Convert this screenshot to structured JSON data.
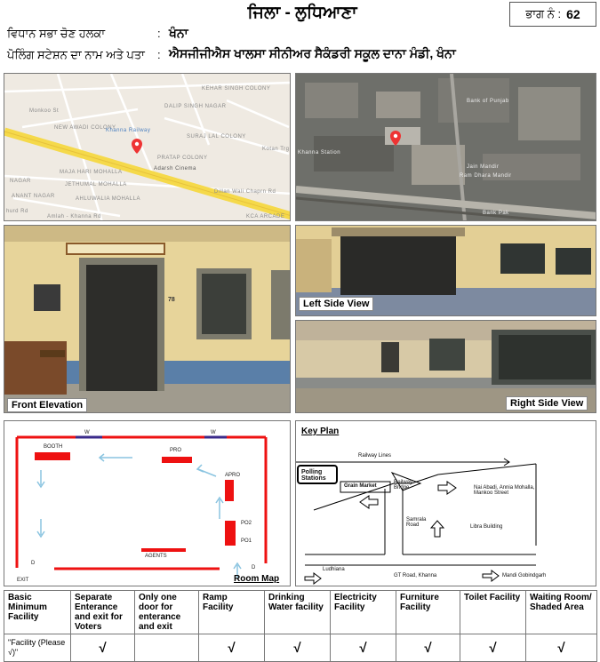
{
  "header": {
    "district": "ਜਿਲਾ - ਲੁਧਿਆਣਾ",
    "part_label": "ਭਾਗ ਨੰ :",
    "part_no": "62",
    "constituency_label": "ਵਿਧਾਨ ਸਭਾ ਚੋਣ ਹਲਕਾ",
    "constituency_value": "ਖੰਨਾ",
    "station_label": "ਪੋਲਿੰਗ ਸਟੇਸ਼ਨ ਦਾ ਨਾਮ ਅਤੇ ਪਤਾ",
    "station_value": "ਐਸਜੀਜੀਐਸ ਖਾਲਸਾ ਸੀਨੀਅਰ ਸੈਕੰਡਰੀ ਸਕੂਲ ਦਾਨਾ ਮੰਡੀ, ਖੰਨਾ",
    "colon": ":"
  },
  "road_map": {
    "labels": [
      "KEHAR SINGH COLONY",
      "Monkoo St",
      "DALIP SINGH NAGAR",
      "NEW AWADI COLONY",
      "Khanna Railway",
      "SURAJ LAL COLONY",
      "PRATAP COLONY",
      "Adarsh Cinema",
      "MAJA HARI MOHALLA",
      "JETHUMAL MOHALLA",
      "NAGAR",
      "ANANT NAGAR",
      "Dillan Wali Chaprn Rd",
      "hurd Rd",
      "Amlah - Khanna Rd",
      "KCA ARCADE",
      "AHLUWALIA MOHALLA",
      "Kotan Trg"
    ]
  },
  "sat_map": {
    "labels": [
      "Khanna Station",
      "Bank of Punjab",
      "Jain Mandir",
      "Ram Dhara Mandir",
      "Bank Pak"
    ]
  },
  "photos": {
    "front": "Front Elevation",
    "left": "Left Side View",
    "right": "Right Side View",
    "room_no": "78"
  },
  "room_map": {
    "title": "Room Map",
    "booth": "BOOTH",
    "pro": "PRO",
    "apro": "APRO",
    "po2": "PO2",
    "po1": "PO1",
    "agents": "AGENTS",
    "exit": "EXIT",
    "w": "W",
    "d": "D"
  },
  "key_plan": {
    "title": "Key Plan",
    "railway_lines": "Railway Lines",
    "polling_stations": "Polling Stations",
    "grain_market": "Grain Market",
    "railway_bridge": "Railway Bridge",
    "nai_abadi": "Nai Abadi, Annia Mohalla, Mankoo Street",
    "samrala_road": "Samrala Road",
    "libra_building": "Libra Building",
    "ludhiana": "Ludhiana",
    "gt_road": "GT Road, Khanna",
    "mandi": "Mandi Gobindgarh"
  },
  "facility": {
    "headers": [
      "Basic Minimum Facility",
      "Separate Enterance and exit for Voters",
      "Only one door for enterance and exit",
      "Ramp Facility",
      "Drinking Water facility",
      "Electricity Facility",
      "Furniture Facility",
      "Toilet Facility",
      "Waiting Room/ Shaded Area"
    ],
    "row_label": "\"Facility (Please √)\"",
    "values": [
      "√",
      "",
      "√",
      "√",
      "√",
      "√",
      "√",
      "√"
    ]
  },
  "colors": {
    "highway": "#f5d94a",
    "map_bg": "#efeae2",
    "wall_yellow": "#e9d79a",
    "wall_blue": "#5a7fa8",
    "room_line": "#e11",
    "room_top_line": "#3a2a8a",
    "arrow": "#8ac4e0"
  }
}
